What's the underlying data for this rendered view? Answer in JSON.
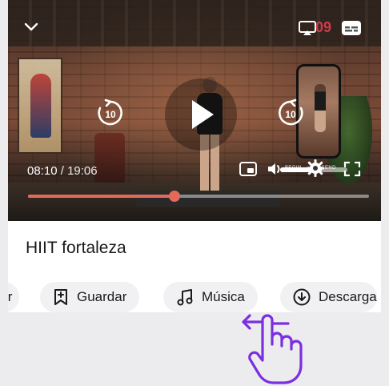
{
  "player": {
    "elapsed": "08:10",
    "separator": "/",
    "duration": "19:06",
    "overlay_digits": "09",
    "volume_text": "BEGIN  · ·  DESCEND",
    "playback_progress": 0.43,
    "volume_level": 0.62
  },
  "video": {
    "title": "HIIT fortaleza"
  },
  "actions": {
    "partial_label": "ir",
    "save_label": "Guardar",
    "music_label": "Música",
    "download_label": "Descarga"
  },
  "icons": {
    "collapse": "chevron-down-icon",
    "cast": "cast-icon",
    "captions": "captions-icon",
    "replay": "replay-10-icon",
    "play": "play-icon",
    "forward": "forward-10-icon",
    "pip": "picture-in-picture-icon",
    "volume": "volume-icon",
    "settings": "gear-icon",
    "fullscreen": "fullscreen-icon",
    "save": "bookmark-plus-icon",
    "music": "music-note-icon",
    "download": "download-icon",
    "swipe": "swipe-left-hand-icon"
  },
  "colors": {
    "accent": "#e36a5a",
    "gesture": "#7b2fe0",
    "chip_bg": "#f1f1f3"
  }
}
